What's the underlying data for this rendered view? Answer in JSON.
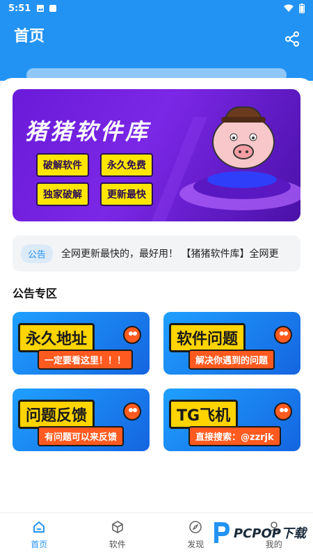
{
  "status_bar": {
    "time": "5:51"
  },
  "app_bar": {
    "title": "首页"
  },
  "banner": {
    "title": "猪猪软件库",
    "tags": [
      "破解软件",
      "永久免费",
      "独家破解",
      "更新最快"
    ]
  },
  "notice": {
    "chip": "公告",
    "text": "全网更新最快的，最好用！  【猪猪软件库】全网更"
  },
  "section": {
    "title": "公告专区"
  },
  "cards": [
    {
      "title": "永久地址",
      "subtitle": "一定要看这里！！！"
    },
    {
      "title": "软件问题",
      "subtitle": "解决你遇到的问题"
    },
    {
      "title": "问题反馈",
      "subtitle": "有问题可以来反馈"
    },
    {
      "title": "TG飞机",
      "subtitle": "直接搜索：@zzrjk"
    }
  ],
  "bottom_nav": [
    {
      "label": "首页",
      "icon": "home-icon",
      "active": true
    },
    {
      "label": "软件",
      "icon": "cube-icon",
      "active": false
    },
    {
      "label": "发现",
      "icon": "compass-icon",
      "active": false
    },
    {
      "label": "我的",
      "icon": "user-icon",
      "active": false
    }
  ],
  "watermark": {
    "text": "PCPOP下载"
  },
  "colors": {
    "primary": "#2393f3",
    "banner": "#7b27e6",
    "tag": "#ffe600"
  }
}
